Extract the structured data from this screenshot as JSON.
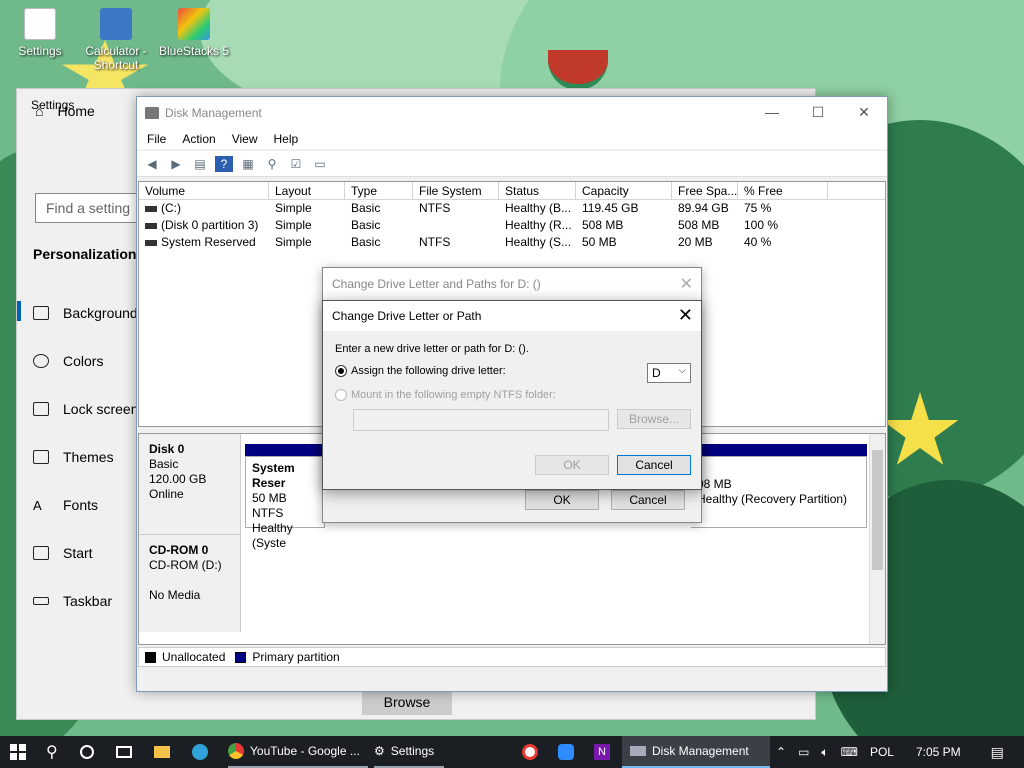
{
  "desktop": {
    "icons": [
      {
        "label": "Settings"
      },
      {
        "label": "Calculator - Shortcut"
      },
      {
        "label": "BlueStacks 5"
      }
    ]
  },
  "settings": {
    "title": "Settings",
    "home": "Home",
    "search_placeholder": "Find a setting",
    "section": "Personalization",
    "nav": [
      "Background",
      "Colors",
      "Lock screen",
      "Themes",
      "Fonts",
      "Start",
      "Taskbar"
    ],
    "browse_label": "Browse"
  },
  "disk_management": {
    "title": "Disk Management",
    "menu": [
      "File",
      "Action",
      "View",
      "Help"
    ],
    "columns": [
      "Volume",
      "Layout",
      "Type",
      "File System",
      "Status",
      "Capacity",
      "Free Spa...",
      "% Free"
    ],
    "rows": [
      [
        "(C:)",
        "Simple",
        "Basic",
        "NTFS",
        "Healthy (B...",
        "119.45 GB",
        "89.94 GB",
        "75 %"
      ],
      [
        "(Disk 0 partition 3)",
        "Simple",
        "Basic",
        "",
        "Healthy (R...",
        "508 MB",
        "508 MB",
        "100 %"
      ],
      [
        "System Reserved",
        "Simple",
        "Basic",
        "NTFS",
        "Healthy (S...",
        "50 MB",
        "20 MB",
        "40 %"
      ]
    ],
    "disk0": {
      "name": "Disk 0",
      "type": "Basic",
      "size": "120.00 GB",
      "state": "Online",
      "part1": {
        "name": "System Reser",
        "size": "50 MB NTFS",
        "status": "Healthy (Syste"
      },
      "part3": {
        "size": "08 MB",
        "status": "Healthy (Recovery Partition)"
      }
    },
    "cdrom": {
      "name": "CD-ROM 0",
      "drive": "CD-ROM (D:)",
      "media": "No Media"
    },
    "legend": [
      "Unallocated",
      "Primary partition"
    ],
    "legend_colors": [
      "#000000",
      "#000080"
    ]
  },
  "dialog_paths": {
    "title": "Change Drive Letter and Paths for D: ()",
    "ok": "OK",
    "cancel": "Cancel"
  },
  "dialog_letter": {
    "title": "Change Drive Letter or Path",
    "instruction": "Enter a new drive letter or path for D: ().",
    "assign_label": "Assign the following drive letter:",
    "drive_letter": "D",
    "mount_label": "Mount in the following empty NTFS folder:",
    "browse": "Browse...",
    "ok": "OK",
    "cancel": "Cancel"
  },
  "taskbar": {
    "apps": [
      {
        "label": "YouTube - Google ..."
      },
      {
        "label": "Settings"
      },
      {
        "label": "Disk Management"
      }
    ],
    "language": "POL",
    "time": "7:05 PM"
  }
}
